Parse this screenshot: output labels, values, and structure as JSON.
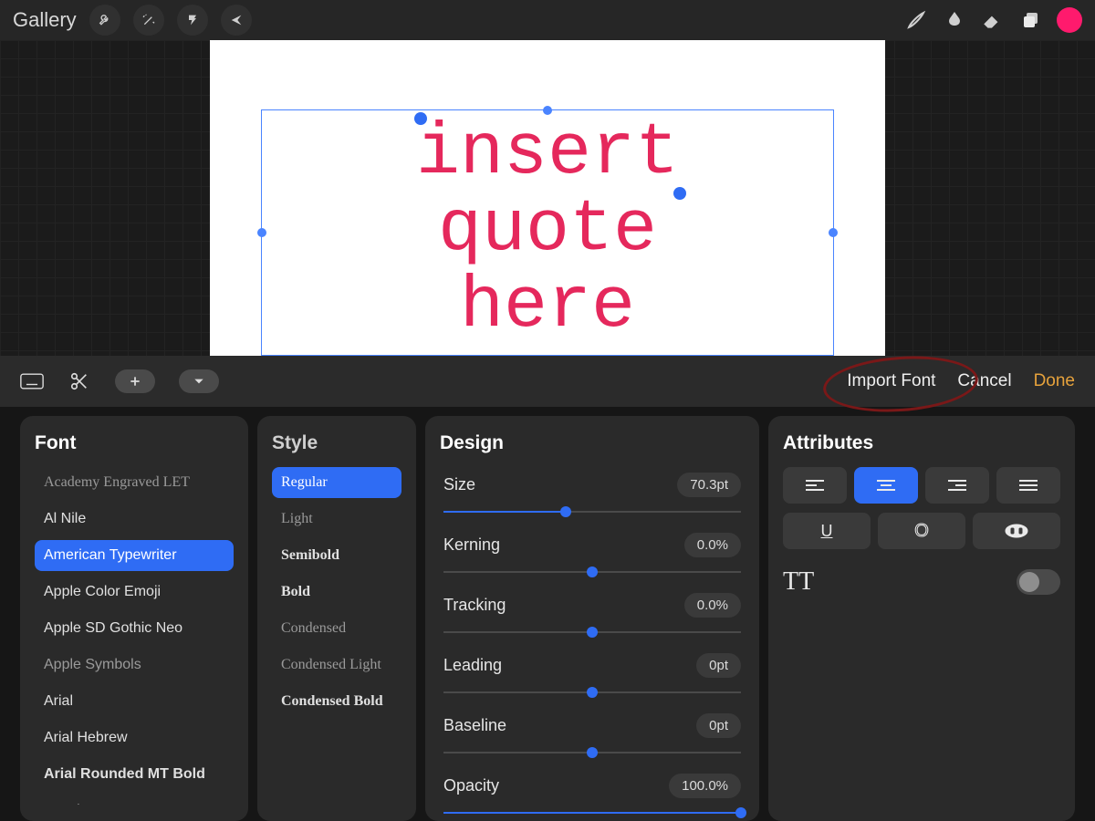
{
  "topbar": {
    "gallery": "Gallery"
  },
  "canvas": {
    "word1": "insert",
    "word2": "quote",
    "word3": "here"
  },
  "panel_header": {
    "import": "Import Font",
    "cancel": "Cancel",
    "done": "Done"
  },
  "font": {
    "title": "Font",
    "items": [
      {
        "label": "Academy Engraved LET",
        "dim": true
      },
      {
        "label": "Al Nile"
      },
      {
        "label": "American Typewriter",
        "selected": true
      },
      {
        "label": "Apple Color Emoji"
      },
      {
        "label": "Apple SD Gothic Neo"
      },
      {
        "label": "Apple Symbols",
        "dim": true
      },
      {
        "label": "Arial"
      },
      {
        "label": "Arial Hebrew"
      },
      {
        "label": "Arial Rounded MT Bold",
        "bold": true
      },
      {
        "label": "Avenir"
      }
    ]
  },
  "style": {
    "title": "Style",
    "items": [
      {
        "label": "Regular",
        "selected": true
      },
      {
        "label": "Light",
        "dim": true
      },
      {
        "label": "Semibold",
        "bold": true
      },
      {
        "label": "Bold",
        "bold": true
      },
      {
        "label": "Condensed",
        "dim": true
      },
      {
        "label": "Condensed Light",
        "dim": true
      },
      {
        "label": "Condensed Bold",
        "bold": true
      }
    ]
  },
  "design": {
    "title": "Design",
    "rows": [
      {
        "label": "Size",
        "value": "70.3pt",
        "fill": 41
      },
      {
        "label": "Kerning",
        "value": "0.0%",
        "fill": 50,
        "center": true
      },
      {
        "label": "Tracking",
        "value": "0.0%",
        "fill": 50,
        "center": true
      },
      {
        "label": "Leading",
        "value": "0pt",
        "fill": 50,
        "center": true
      },
      {
        "label": "Baseline",
        "value": "0pt",
        "fill": 50,
        "center": true
      },
      {
        "label": "Opacity",
        "value": "100.0%",
        "fill": 100
      }
    ]
  },
  "attributes": {
    "title": "Attributes",
    "align_selected": 1,
    "tt": "TT"
  }
}
